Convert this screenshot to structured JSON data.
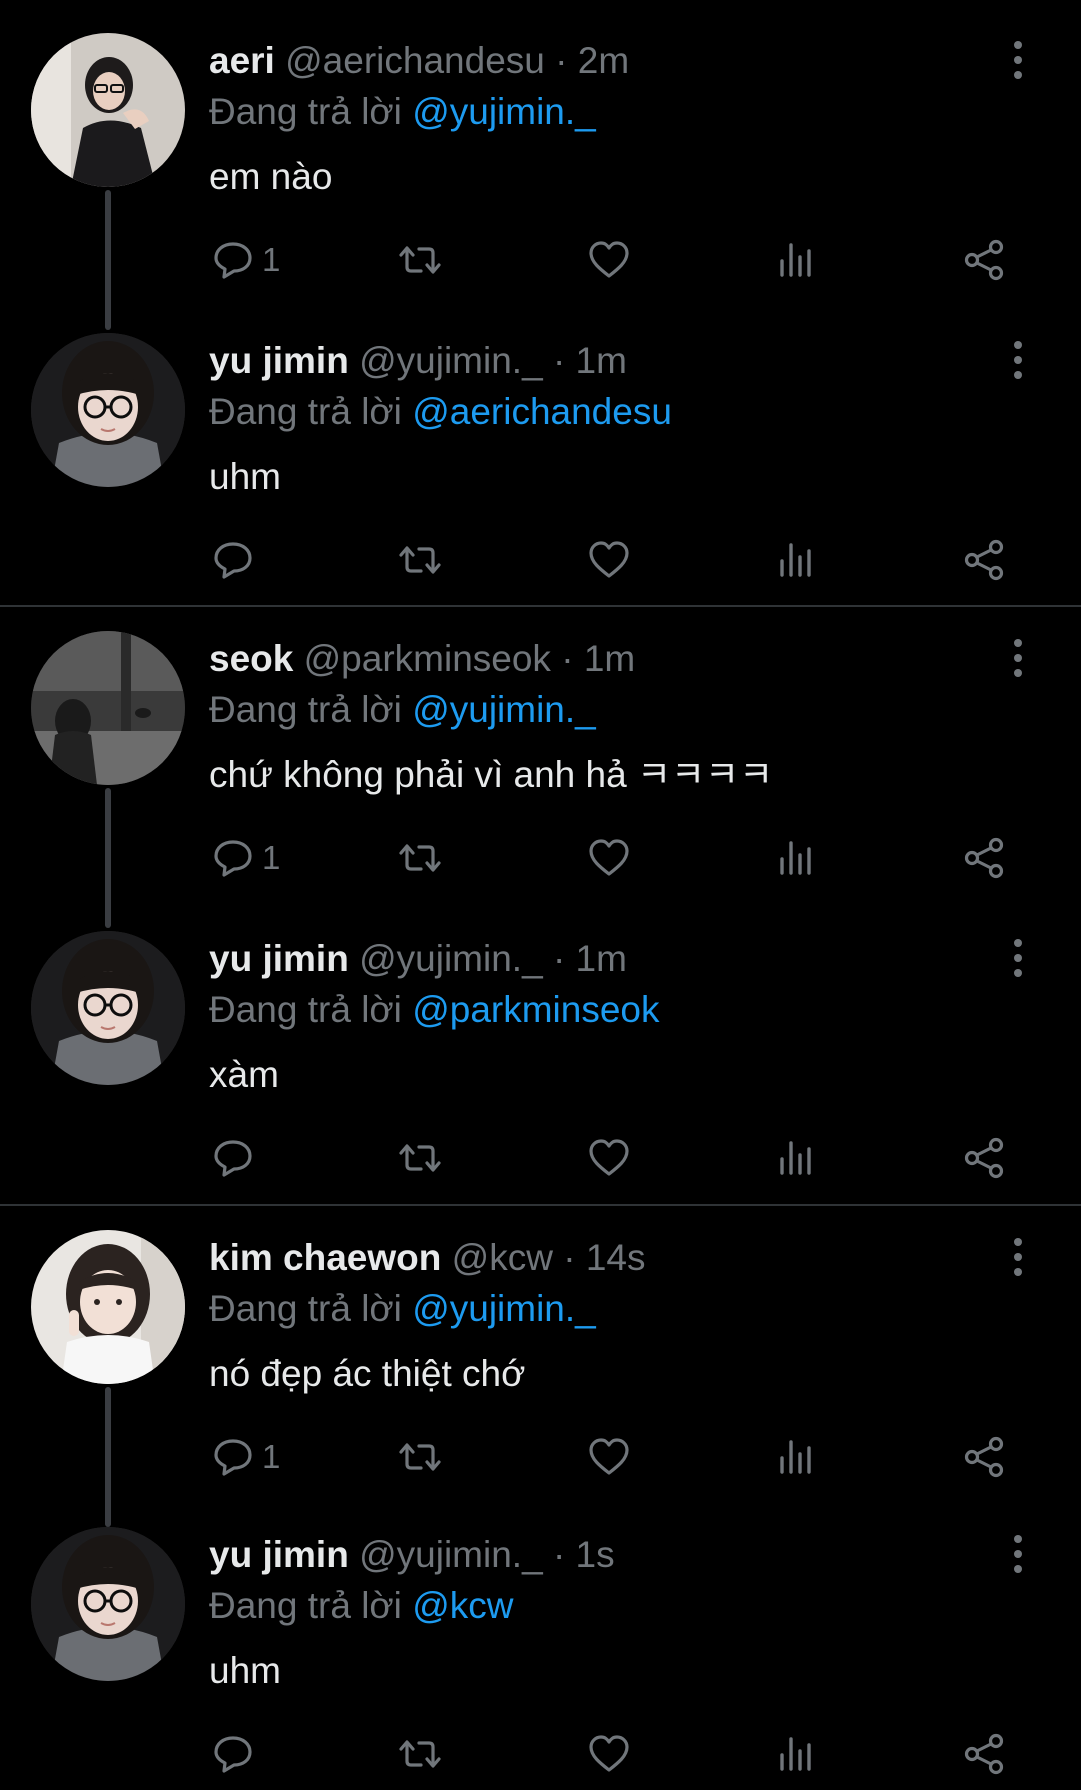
{
  "colors": {
    "background": "#000000",
    "text": "#e7e9ea",
    "muted": "#71767b",
    "link": "#1d9bf0",
    "divider": "#2f3336",
    "thread_line": "#3a3d42"
  },
  "separator": "·",
  "reply_prefix": "Đang trả lời",
  "tweets": [
    {
      "name": "aeri",
      "handle": "@aerichandesu",
      "time": "2m",
      "reply_to": "@yujimin._",
      "text": "em nào",
      "reply_count": "1",
      "avatar": "aeri-avatar"
    },
    {
      "name": "yu jimin",
      "handle": "@yujimin._",
      "time": "1m",
      "reply_to": "@aerichandesu",
      "text": "uhm",
      "reply_count": "",
      "avatar": "jimin-avatar"
    },
    {
      "name": "seok",
      "handle": "@parkminseok",
      "time": "1m",
      "reply_to": "@yujimin._",
      "text": "chứ không phải vì anh hả ㅋㅋㅋㅋ",
      "reply_count": "1",
      "avatar": "seok-avatar"
    },
    {
      "name": "yu jimin",
      "handle": "@yujimin._",
      "time": "1m",
      "reply_to": "@parkminseok",
      "text": "xàm",
      "reply_count": "",
      "avatar": "jimin-avatar"
    },
    {
      "name": "kim chaewon",
      "handle": "@kcw",
      "time": "14s",
      "reply_to": "@yujimin._",
      "text": "nó đẹp ác thiệt chớ",
      "reply_count": "1",
      "avatar": "chaewon-avatar"
    },
    {
      "name": "yu jimin",
      "handle": "@yujimin._",
      "time": "1s",
      "reply_to": "@kcw",
      "text": "uhm",
      "reply_count": "",
      "avatar": "jimin-avatar"
    }
  ]
}
